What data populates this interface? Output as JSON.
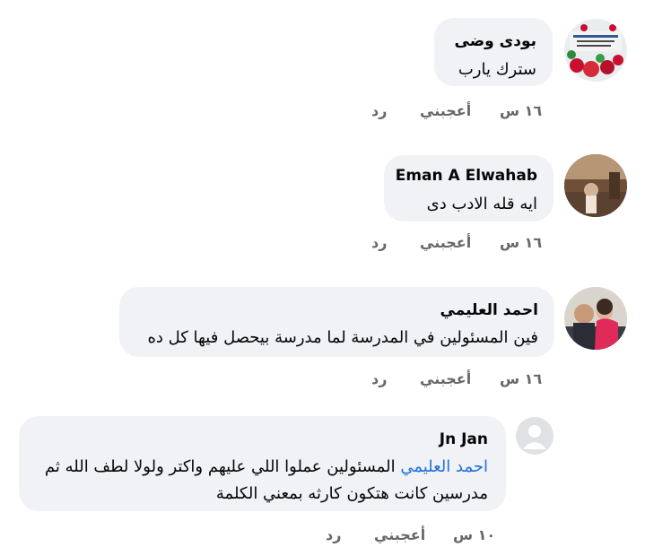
{
  "comments": [
    {
      "name": "بودى وضى",
      "text": "سترك يارب",
      "time": "١٦ س",
      "like": "أعجبني",
      "reply": "رد"
    },
    {
      "name": "Eman A Elwahab",
      "text": "ايه قله الادب دى",
      "time": "١٦ س",
      "like": "أعجبني",
      "reply": "رد"
    },
    {
      "name": "احمد العليمي",
      "text": "فين المسئولين في المدرسة لما مدرسة بيحصل فيها كل ده",
      "time": "١٦ س",
      "like": "أعجبني",
      "reply": "رد"
    },
    {
      "name": "Jn Jan",
      "mention": "احمد العليمي",
      "text_line1": "المسئولين عملوا اللي عليهم واكتر ولولا لطف الله ثم",
      "text_line2": "مدرسين كانت هتكون كارثه بمعني الكلمة",
      "time": "١٠ س",
      "like": "أعجبني",
      "reply": "رد"
    }
  ],
  "avatars": [
    "decorated-roses-avatar",
    "landscape-photo-avatar",
    "man-with-child-avatar",
    "default-user-avatar"
  ]
}
